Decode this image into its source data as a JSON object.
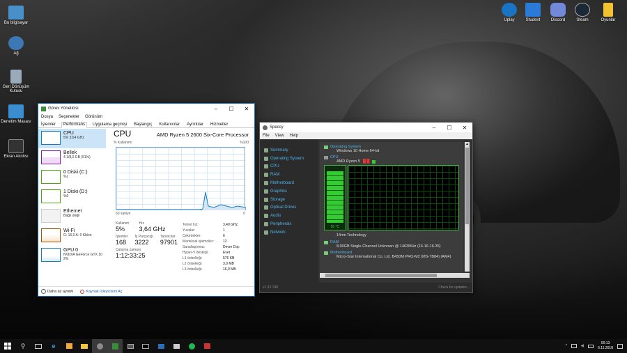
{
  "desktop": {
    "left_icons": [
      {
        "label": "Bu bilgisayar",
        "color": "#4a90c8"
      },
      {
        "label": "Ağ",
        "color": "#3c78b4"
      },
      {
        "label": "Geri Dönüşüm Kutusu",
        "color": "#9ab"
      },
      {
        "label": "Denetim Masası",
        "color": "#3a8ed0"
      },
      {
        "label": "Ekran Alıntısı",
        "color": "#333"
      }
    ],
    "top_icons": [
      {
        "label": "Uplay",
        "color": "#1a74c4"
      },
      {
        "label": "Student",
        "color": "#2a7ad8"
      },
      {
        "label": "Discord",
        "color": "#7289da"
      },
      {
        "label": "Steam",
        "color": "#1b2838"
      },
      {
        "label": "Oyunlar",
        "color": "#f2c230"
      }
    ]
  },
  "taskmanager": {
    "title": "Görev Yöneticisi",
    "menu": [
      "Dosya",
      "Seçenekler",
      "Görünüm"
    ],
    "tabs": [
      "İşlemler",
      "Performans",
      "Uygulama geçmişi",
      "Başlangıç",
      "Kullanıcılar",
      "Ayrıntılar",
      "Hizmetler"
    ],
    "active_tab": "Performans",
    "left_items": [
      {
        "name": "CPU",
        "sub": "5% 3,64 GHz",
        "color": "#117dbb"
      },
      {
        "name": "Bellek",
        "sub": "4,1/8,0 GB (51%)",
        "color": "#8b12ae"
      },
      {
        "name": "0 Diski (C:)",
        "sub": "%1",
        "color": "#4da60c"
      },
      {
        "name": "1 Diski (D:)",
        "sub": "%0",
        "color": "#4da60c"
      },
      {
        "name": "Ethernet",
        "sub": "Bağlı değil",
        "color": "#a74f01"
      },
      {
        "name": "Wi-Fi",
        "sub": "G: 16,0 A: 0 Kb/sn",
        "color": "#a74f01"
      },
      {
        "name": "GPU 0",
        "sub": "NVIDIA GeForce GTX 10",
        "sub2": "2%",
        "color": "#117dbb"
      }
    ],
    "cpu": {
      "heading": "CPU",
      "model": "AMD Ryzen 5 2600 Six-Core Processor",
      "graph_label": "% Kullanımı",
      "graph_max": "%100",
      "graph_time": "60 saniye",
      "graph_min": "0",
      "usage_label": "Kullanım",
      "usage_value": "5%",
      "speed_label": "Hız",
      "speed_value": "3,64 GHz",
      "processes_label": "İşlemler",
      "processes_value": "168",
      "threads_label": "İş Parçacığı",
      "threads_value": "3222",
      "handles_label": "Tanıtıcılar",
      "handles_value": "97901",
      "uptime_label": "Çalışma zamanı",
      "uptime_value": "1:12:33:25",
      "details": [
        {
          "k": "Temel hız:",
          "v": "3,40 GHz"
        },
        {
          "k": "Yuvalar:",
          "v": "1"
        },
        {
          "k": "Çekirdekler:",
          "v": "6"
        },
        {
          "k": "Mantıksal işlemciler:",
          "v": "12"
        },
        {
          "k": "Sanallaştırma:",
          "v": "Devre Dışı"
        },
        {
          "k": "Hyper-V desteği:",
          "v": "Evet"
        },
        {
          "k": "L1 önbelleği:",
          "v": "576 KB"
        },
        {
          "k": "L2 önbelleği:",
          "v": "3,0 MB"
        },
        {
          "k": "L3 önbelleği:",
          "v": "16,0 MB"
        }
      ]
    },
    "footer_less": "Daha az ayrıntı",
    "footer_monitor": "Kaynak İzleyicisini Aç"
  },
  "speccy": {
    "title": "Speccy",
    "menu": [
      "File",
      "View",
      "Help"
    ],
    "sidebar": [
      "Summary",
      "Operating System",
      "CPU",
      "RAM",
      "Motherboard",
      "Graphics",
      "Storage",
      "Optical Drives",
      "Audio",
      "Peripherals",
      "Network"
    ],
    "os_heading": "Operating System",
    "os_value": "Windows 10 Home 64-bit",
    "cpu_heading": "CPU",
    "cpu_value": "AMD Ryzen 5",
    "cpu_temp_hidden": "",
    "temp_value": "55 °C",
    "cpu_tech": "14nm Technology",
    "ram_heading": "RAM",
    "ram_value": "8,00GB Single-Channel Unknown @ 1463MHz (16-16-16-35)",
    "mb_heading": "Motherboard",
    "mb_value": "Micro-Star International Co. Ltd. B450M PRO-M2 (MS-7B84) (AM4)",
    "version": "v1.32.740",
    "check": "Check for updates..."
  },
  "taskbar": {
    "time": "00:13",
    "date": "6.11.2018"
  }
}
